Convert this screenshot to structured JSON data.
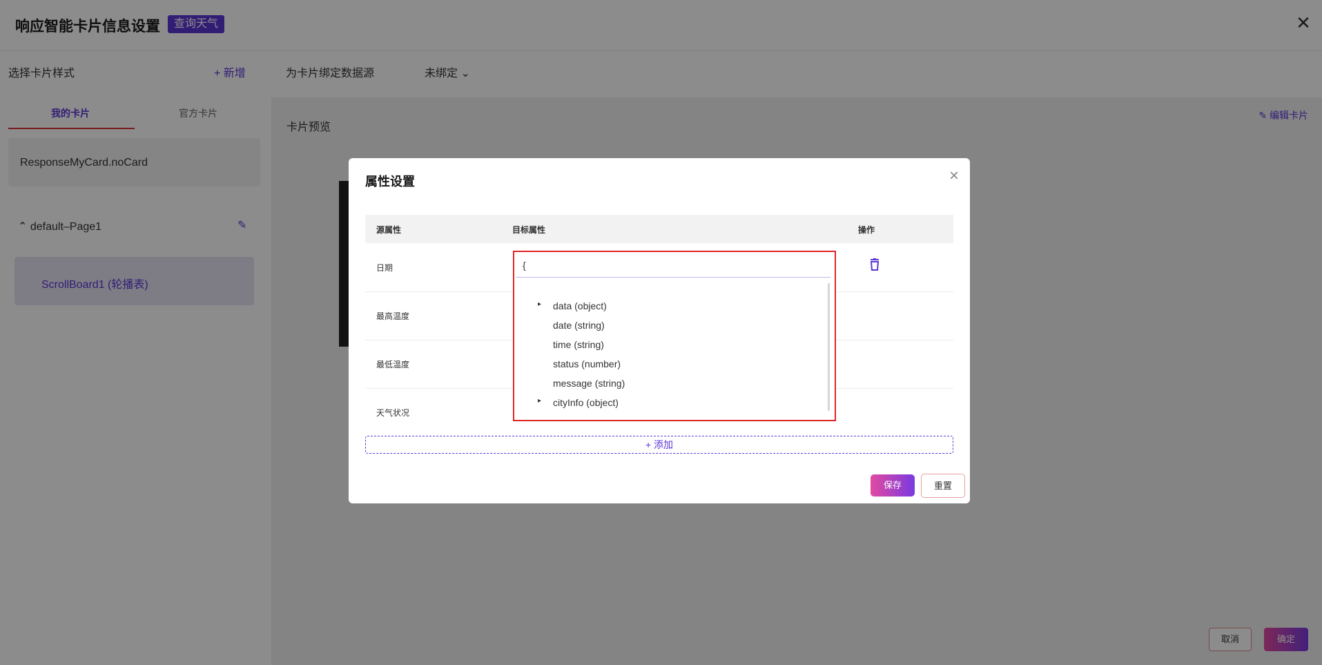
{
  "header": {
    "title": "响应智能卡片信息设置",
    "tag": "查询天气",
    "close": "✕"
  },
  "left": {
    "section_title": "选择卡片样式",
    "add_new": "+ 新增",
    "tabs": [
      "我的卡片",
      "官方卡片"
    ],
    "card_item": "ResponseMyCard.noCard",
    "page_row": "default–Page1",
    "component_item": "ScrollBoard1 (轮播表)"
  },
  "binding": {
    "label": "为卡片绑定数据源",
    "value": "未绑定"
  },
  "preview": {
    "title": "卡片预览",
    "edit": "编辑卡片"
  },
  "footer": {
    "cancel": "取消",
    "ok": "确定"
  },
  "modal": {
    "title": "属性设置",
    "headers": {
      "source": "源属性",
      "target": "目标属性",
      "action": "操作"
    },
    "rows": [
      "日期",
      "最高温度",
      "最低温度",
      "天气状况"
    ],
    "add_label": "+ 添加",
    "save": "保存",
    "reset": "重置",
    "dropdown": {
      "input_value": "{",
      "items": [
        {
          "label": "data (object)",
          "expandable": true
        },
        {
          "label": "date (string)",
          "expandable": false
        },
        {
          "label": "time (string)",
          "expandable": false
        },
        {
          "label": "status (number)",
          "expandable": false
        },
        {
          "label": "message (string)",
          "expandable": false
        },
        {
          "label": "cityInfo (object)",
          "expandable": true
        }
      ]
    }
  },
  "colors": {
    "accent": "#5b35d5",
    "highlight_border": "#e12222",
    "overlay": "rgba(0,0,0,0.45)"
  }
}
